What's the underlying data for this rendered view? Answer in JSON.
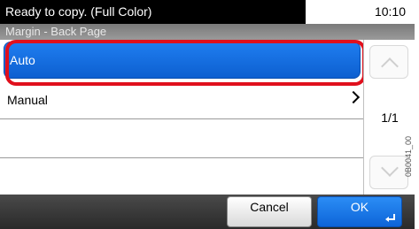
{
  "status": {
    "message": "Ready to copy. (Full Color)",
    "time": "10:10"
  },
  "header": {
    "title": "Margin - Back Page"
  },
  "options": [
    {
      "label": "Auto",
      "selected": true
    },
    {
      "label": "Manual",
      "has_submenu": true
    },
    {
      "label": ""
    },
    {
      "label": ""
    }
  ],
  "pager": {
    "indicator": "1/1"
  },
  "footer": {
    "cancel_label": "Cancel",
    "ok_label": "OK"
  },
  "side_code": "0B0041_00",
  "colors": {
    "accent": "#0d5fd0",
    "highlight_ring": "#e0101d"
  }
}
